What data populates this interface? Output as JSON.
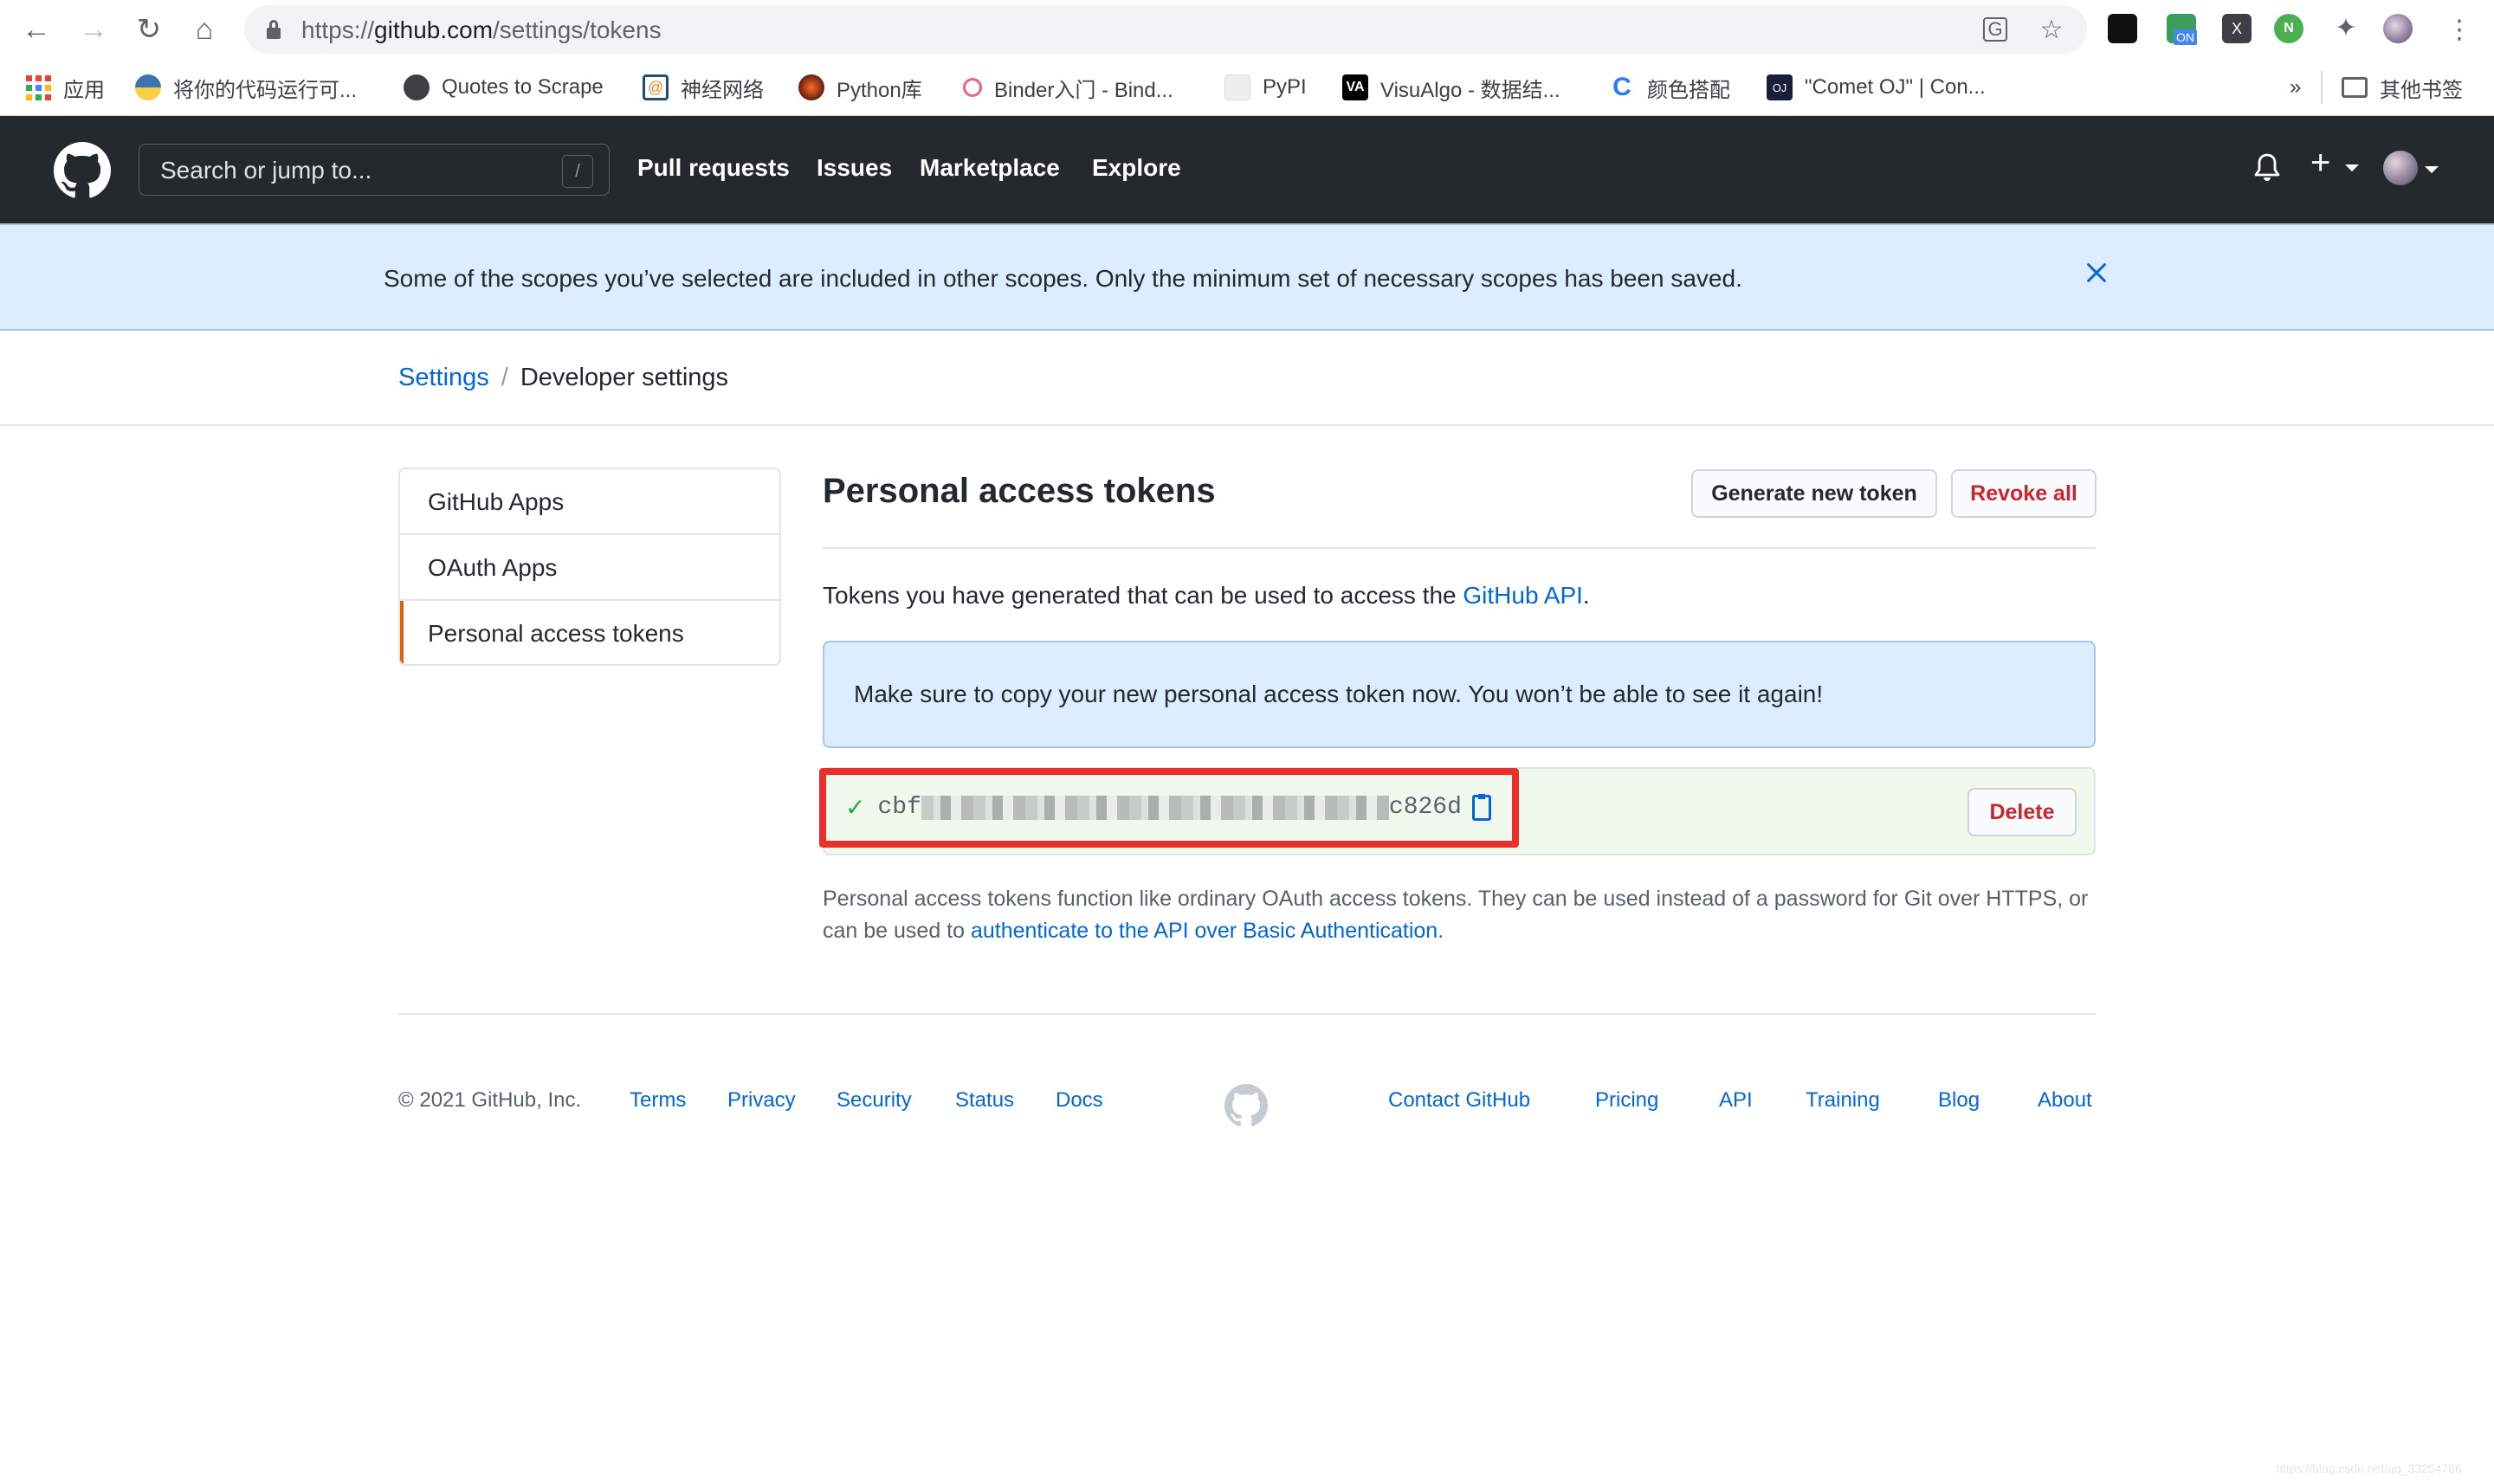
{
  "browser": {
    "url_prefix": "https://",
    "url_host": "github.com",
    "url_path": "/settings/tokens",
    "ext_badge": "ON",
    "bookmarks": [
      {
        "label": "应用",
        "icon": "apps-grid-icon"
      },
      {
        "label": "将你的代码运行可...",
        "icon": "python-icon"
      },
      {
        "label": "Quotes to Scrape",
        "icon": "globe-icon"
      },
      {
        "label": "神经网络",
        "icon": "spiral-icon"
      },
      {
        "label": "Python库",
        "icon": "python-lib-icon"
      },
      {
        "label": "Binder入门 - Bind...",
        "icon": "binder-icon"
      },
      {
        "label": "PyPI",
        "icon": "pypi-icon"
      },
      {
        "label": "VisuAlgo - 数据结...",
        "icon": "visualgo-icon"
      },
      {
        "label": "颜色搭配",
        "icon": "c-logo-icon"
      },
      {
        "label": "\"Comet OJ\" | Con...",
        "icon": "oj-icon"
      }
    ],
    "overflow": "»",
    "other_bookmarks": "其他书签"
  },
  "header": {
    "search_placeholder": "Search or jump to...",
    "search_shortcut": "/",
    "nav": [
      "Pull requests",
      "Issues",
      "Marketplace",
      "Explore"
    ]
  },
  "flash": {
    "message": "Some of the scopes you’ve selected are included in other scopes. Only the minimum set of necessary scopes has been saved."
  },
  "breadcrumb": {
    "parent": "Settings",
    "separator": "/",
    "current": "Developer settings"
  },
  "sidebar": {
    "items": [
      {
        "label": "GitHub Apps",
        "selected": false
      },
      {
        "label": "OAuth Apps",
        "selected": false
      },
      {
        "label": "Personal access tokens",
        "selected": true
      }
    ]
  },
  "main": {
    "title": "Personal access tokens",
    "generate_button": "Generate new token",
    "revoke_button": "Revoke all",
    "description_prefix": "Tokens you have generated that can be used to access the ",
    "description_link": "GitHub API",
    "description_suffix": ".",
    "notice": "Make sure to copy your new personal access token now. You won’t be able to see it again!",
    "token": {
      "prefix": "cbf",
      "suffix": "c826d",
      "redacted": true
    },
    "delete_button": "Delete",
    "note_text": "Personal access tokens function like ordinary OAuth access tokens. They can be used instead of a password for Git over HTTPS, or can be used to ",
    "note_link": "authenticate to the API over Basic Authentication",
    "note_suffix": "."
  },
  "footer": {
    "copyright": "© 2021 GitHub, Inc.",
    "left_links": [
      "Terms",
      "Privacy",
      "Security",
      "Status",
      "Docs"
    ],
    "right_links": [
      "Contact GitHub",
      "Pricing",
      "API",
      "Training",
      "Blog",
      "About"
    ]
  },
  "watermark": "https://blog.csdn.net/qq_33254766",
  "colors": {
    "header_bg": "#24292e",
    "link": "#0366d6",
    "danger": "#cb2431",
    "flash_bg": "#dbedff",
    "token_bg": "#f0f8ee",
    "highlight": "#e8302b"
  }
}
